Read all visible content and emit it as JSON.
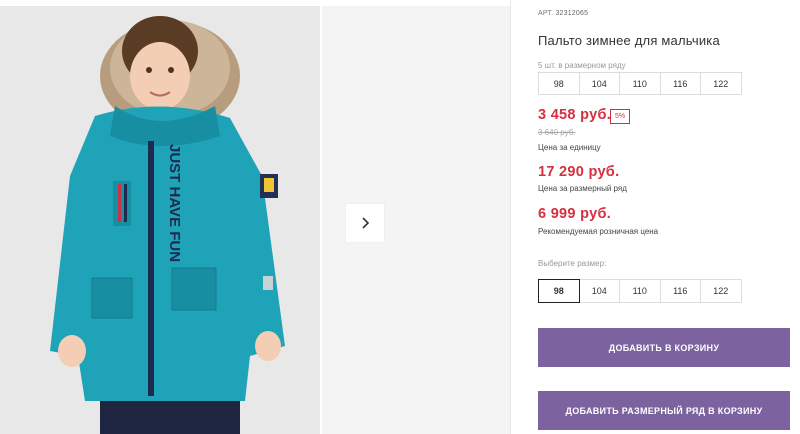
{
  "gallery": {
    "next_icon": "chevron-right-icon",
    "jacket_print": "JUST HAVE FUN"
  },
  "product": {
    "art_label": "АРТ.",
    "art_number": "32312065",
    "title": "Пальто зимнее для мальчика",
    "pack_label": "5 шт. в размерном ряду",
    "pack_sizes": [
      "98",
      "104",
      "110",
      "116",
      "122"
    ],
    "price": "3 458 руб.",
    "discount": "5%",
    "old_price": "3 640 руб.",
    "unit_note": "Цена за единицу",
    "pack_price": "17 290 руб.",
    "pack_note": "Цена за размерный ряд",
    "rrp_price": "6 999 руб.",
    "rrp_note": "Рекомендуемая розничная цена",
    "choose_label": "Выберите размер:",
    "select_sizes": [
      "98",
      "104",
      "110",
      "116",
      "122"
    ],
    "selected_size": "98"
  },
  "buttons": {
    "add_to_cart": "ДОБАВИТЬ В КОРЗИНУ",
    "add_pack_to_cart": "ДОБАВИТЬ РАЗМЕРНЫЙ РЯД В КОРЗИНУ"
  },
  "colors": {
    "price_red": "#d62f3f",
    "button_purple": "#7c629f",
    "jacket_teal": "#1fa3b8"
  }
}
